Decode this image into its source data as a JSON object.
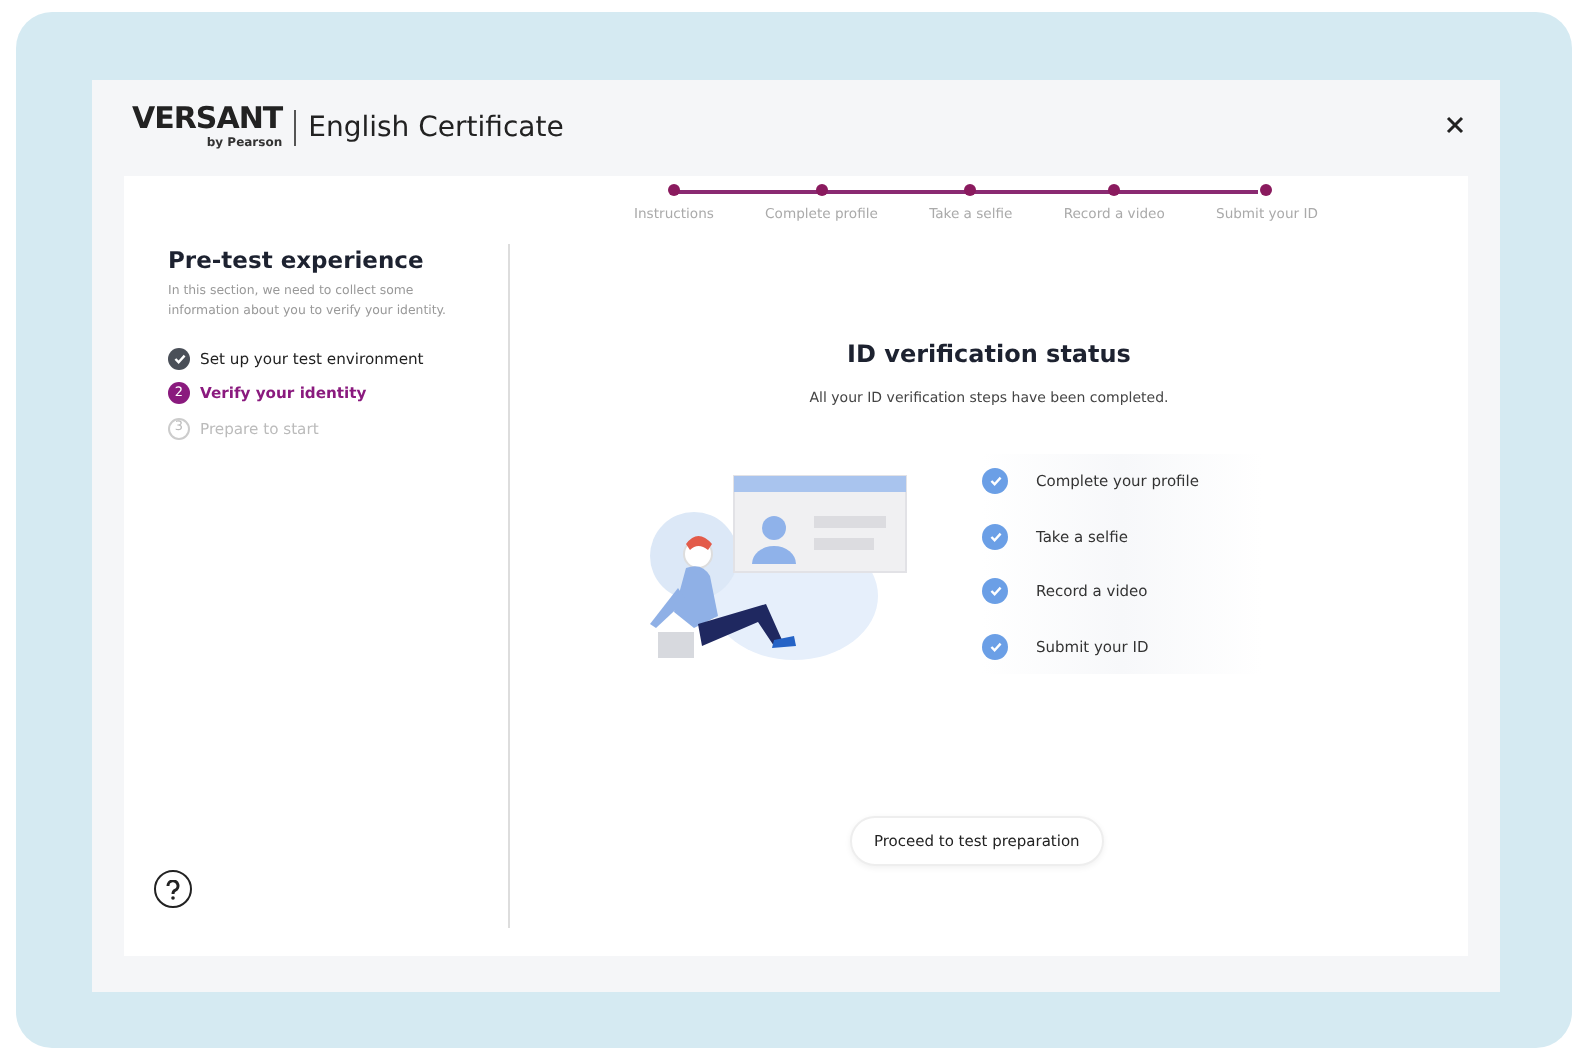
{
  "header": {
    "brand": "VERSANT",
    "brand_sub": "by Pearson",
    "title": "English Certificate"
  },
  "sidebar": {
    "title": "Pre-test experience",
    "description": "In this section, we need to collect some information about you to verify your identity.",
    "steps": [
      {
        "label": "Set up your test environment",
        "kind": "done"
      },
      {
        "number": "2",
        "label": "Verify your identity",
        "kind": "current"
      },
      {
        "number": "3",
        "label": "Prepare to start",
        "kind": "upcoming"
      }
    ]
  },
  "progress": [
    {
      "label": "Instructions",
      "completed": true
    },
    {
      "label": "Complete profile",
      "completed": true
    },
    {
      "label": "Take a selfie",
      "completed": true
    },
    {
      "label": "Record a video",
      "completed": true
    },
    {
      "label": "Submit your ID",
      "completed": true
    }
  ],
  "status": {
    "title": "ID verification status",
    "subtitle": "All your ID verification steps have been completed.",
    "items": [
      {
        "label": "Complete your profile",
        "checked": true
      },
      {
        "label": "Take a selfie",
        "checked": true
      },
      {
        "label": "Record a video",
        "checked": true
      },
      {
        "label": "Submit your ID",
        "checked": true
      }
    ]
  },
  "button": "Proceed to test preparation"
}
